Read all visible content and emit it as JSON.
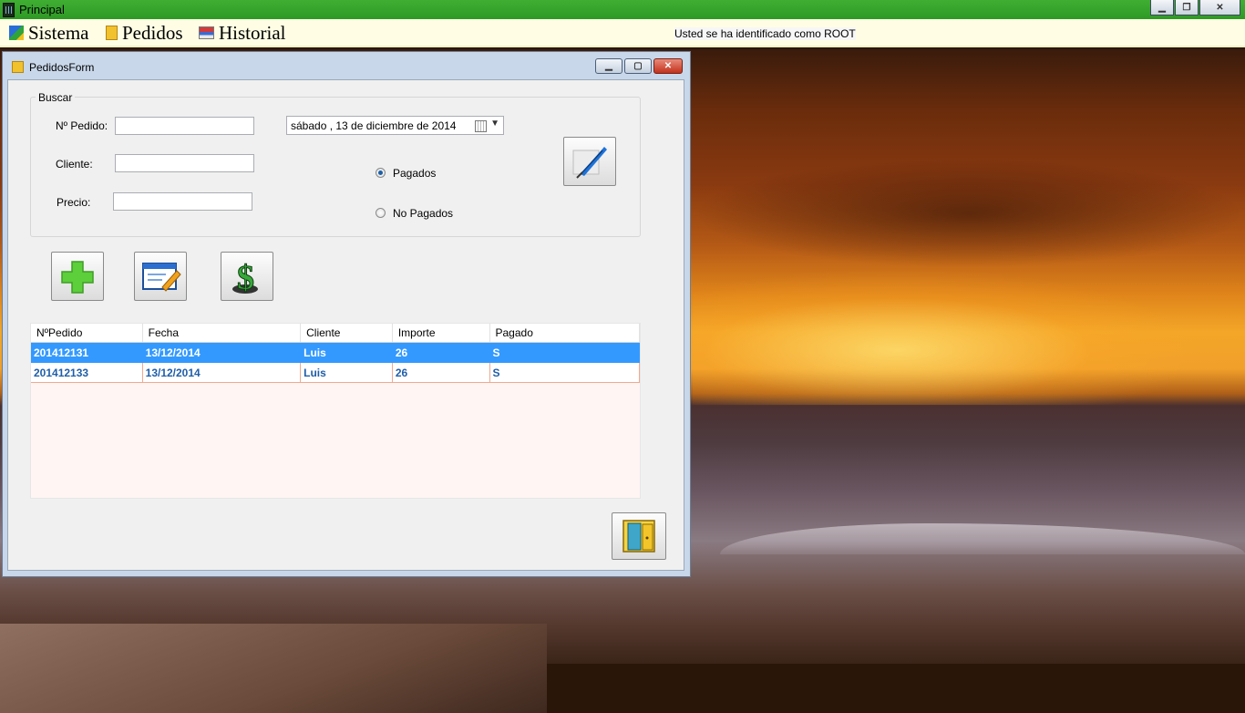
{
  "window": {
    "title": "Principal"
  },
  "menu": {
    "items": [
      {
        "label": "Sistema",
        "icon": "sistema-icon"
      },
      {
        "label": "Pedidos",
        "icon": "pedidos-icon"
      },
      {
        "label": "Historial",
        "icon": "historial-icon"
      }
    ],
    "status": "Usted se ha identificado como ROOT"
  },
  "form": {
    "title": "PedidosForm",
    "search": {
      "legend": "Buscar",
      "pedido_label": "Nº Pedido:",
      "pedido_value": "",
      "cliente_label": "Cliente:",
      "cliente_value": "",
      "precio_label": "Precio:",
      "precio_value": "",
      "date_value": "sábado  , 13 de  diciembre  de 2014",
      "radio_pagados": "Pagados",
      "radio_no_pagados": "No Pagados",
      "selected_radio": "Pagados"
    },
    "grid": {
      "columns": [
        "NºPedido",
        "Fecha",
        "Cliente",
        "Importe",
        "Pagado"
      ],
      "rows": [
        [
          "201412131",
          "13/12/2014",
          "Luis",
          "26",
          "S"
        ],
        [
          "201412133",
          "13/12/2014",
          "Luis",
          "26",
          "S"
        ]
      ],
      "selected_row": 0
    }
  },
  "colors": {
    "title_bar": "#3fae32",
    "menu_bg": "#fffee5",
    "selection": "#3399ff",
    "cell_text": "#1f5ea8"
  }
}
